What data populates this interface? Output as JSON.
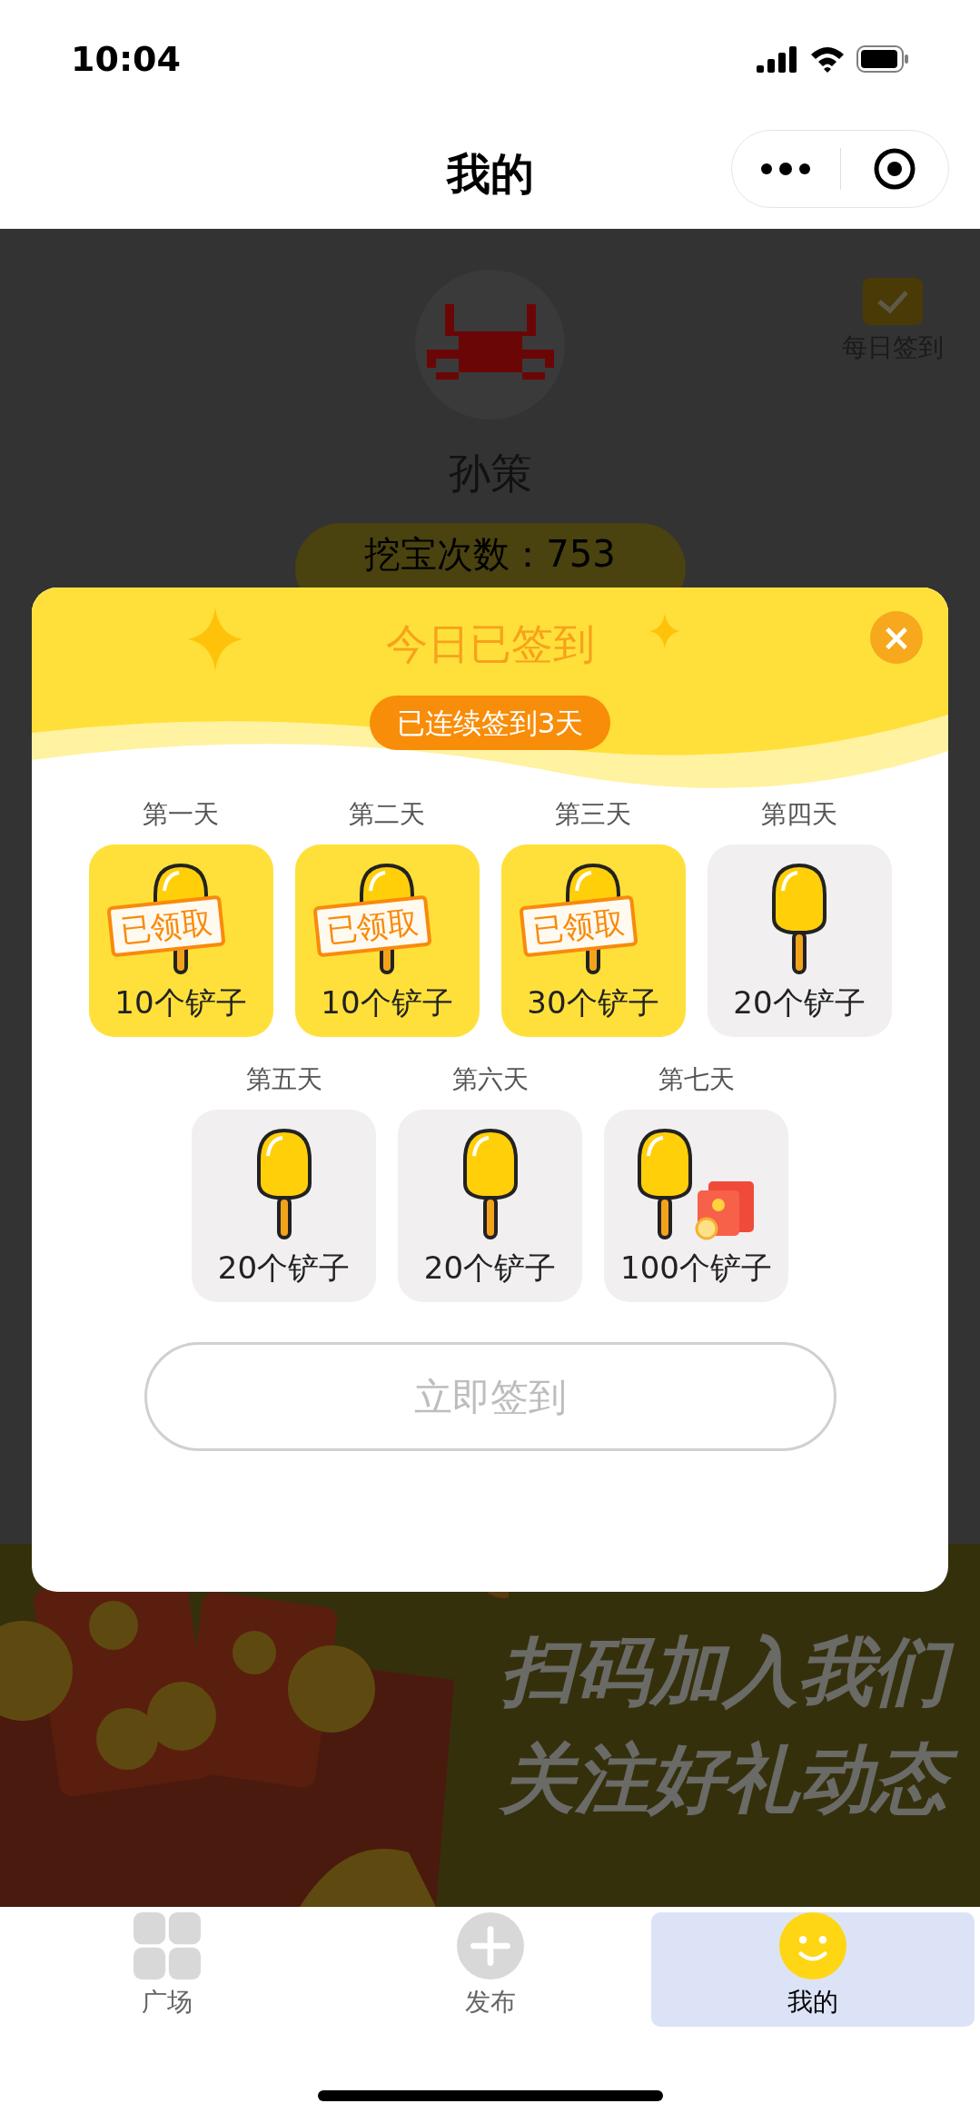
{
  "status_bar": {
    "time": "10:04"
  },
  "header": {
    "title": "我的"
  },
  "profile": {
    "name": "孙策",
    "dig_count": "挖宝次数：753",
    "checkin_label": "每日签到"
  },
  "banner": {
    "lines": [
      "扫码加入我们",
      "关注好礼动态"
    ]
  },
  "checkin_dialog": {
    "title": "今日已签到",
    "streak": "已连续签到3天",
    "close": "×",
    "days": [
      {
        "label": "第一天",
        "reward": "10个铲子",
        "claimed": true,
        "stamp": "已领取",
        "kind": "shovel"
      },
      {
        "label": "第二天",
        "reward": "10个铲子",
        "claimed": true,
        "stamp": "已领取",
        "kind": "shovel"
      },
      {
        "label": "第三天",
        "reward": "30个铲子",
        "claimed": true,
        "stamp": "已领取",
        "kind": "shovel"
      },
      {
        "label": "第四天",
        "reward": "20个铲子",
        "claimed": false,
        "kind": "shovel"
      },
      {
        "label": "第五天",
        "reward": "20个铲子",
        "claimed": false,
        "kind": "shovel"
      },
      {
        "label": "第六天",
        "reward": "20个铲子",
        "claimed": false,
        "kind": "shovel"
      },
      {
        "label": "第七天",
        "reward": "100个铲子",
        "claimed": false,
        "kind": "shovel_gift"
      }
    ],
    "button": {
      "label": "立即签到",
      "disabled": true
    }
  },
  "tab_bar": [
    {
      "label": "广场",
      "selected": false,
      "kind": "grid"
    },
    {
      "label": "发布",
      "selected": false,
      "kind": "plus"
    },
    {
      "label": "我的",
      "selected": true,
      "kind": "smile"
    }
  ]
}
